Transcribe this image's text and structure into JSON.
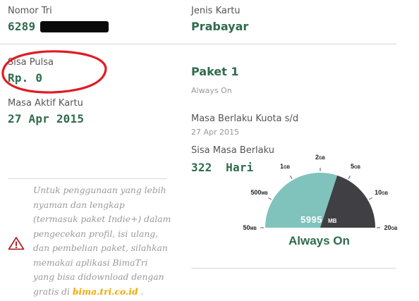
{
  "account": {
    "nomor_label": "Nomor Tri",
    "nomor_prefix": "6289",
    "jenis_label": "Jenis Kartu",
    "jenis_value": "Prabayar",
    "pulsa_label": "Sisa Pulsa",
    "pulsa_value": "Rp. 0",
    "masa_aktif_label": "Masa Aktif Kartu",
    "masa_aktif_value": "27 Apr 2015"
  },
  "package": {
    "name": "Paket 1",
    "type": "Always On",
    "kuota_label": "Masa Berlaku Kuota s/d",
    "kuota_date": "27 Apr 2015",
    "sisa_label": "Sisa Masa Berlaku",
    "sisa_value": "322  Hari"
  },
  "gauge": {
    "tick_labels": [
      {
        "num": "50",
        "unit": "MB"
      },
      {
        "num": "500",
        "unit": "MB"
      },
      {
        "num": "1",
        "unit": "GB"
      },
      {
        "num": "2",
        "unit": "GB"
      },
      {
        "num": "5",
        "unit": "GB"
      },
      {
        "num": "10",
        "unit": "GB"
      },
      {
        "num": "20",
        "unit": "GB"
      }
    ],
    "value_num": "5995",
    "value_unit": "MB",
    "status": "Always On",
    "fill_fraction": 0.6,
    "colors": {
      "fill": "#80c3bd",
      "rest": "#3f3f44",
      "text": "#ffffff"
    }
  },
  "notice": {
    "lines": [
      "Untuk penggunaan yang lebih",
      "nyaman dan lengkap",
      "(termasuk paket Indie+) dalam",
      "pengecekan profil, isi ulang,",
      "dan pembelian paket, silahkan",
      "memakai aplikasi BimaTri",
      "yang bisa didownload dengan"
    ],
    "last_prefix": "gratis di ",
    "link": "bima.tri.co.id",
    "last_suffix": " ."
  },
  "colors": {
    "accent_green": "#2f6b4c",
    "highlight_red": "#e01b24",
    "link_orange": "#f1a800"
  }
}
